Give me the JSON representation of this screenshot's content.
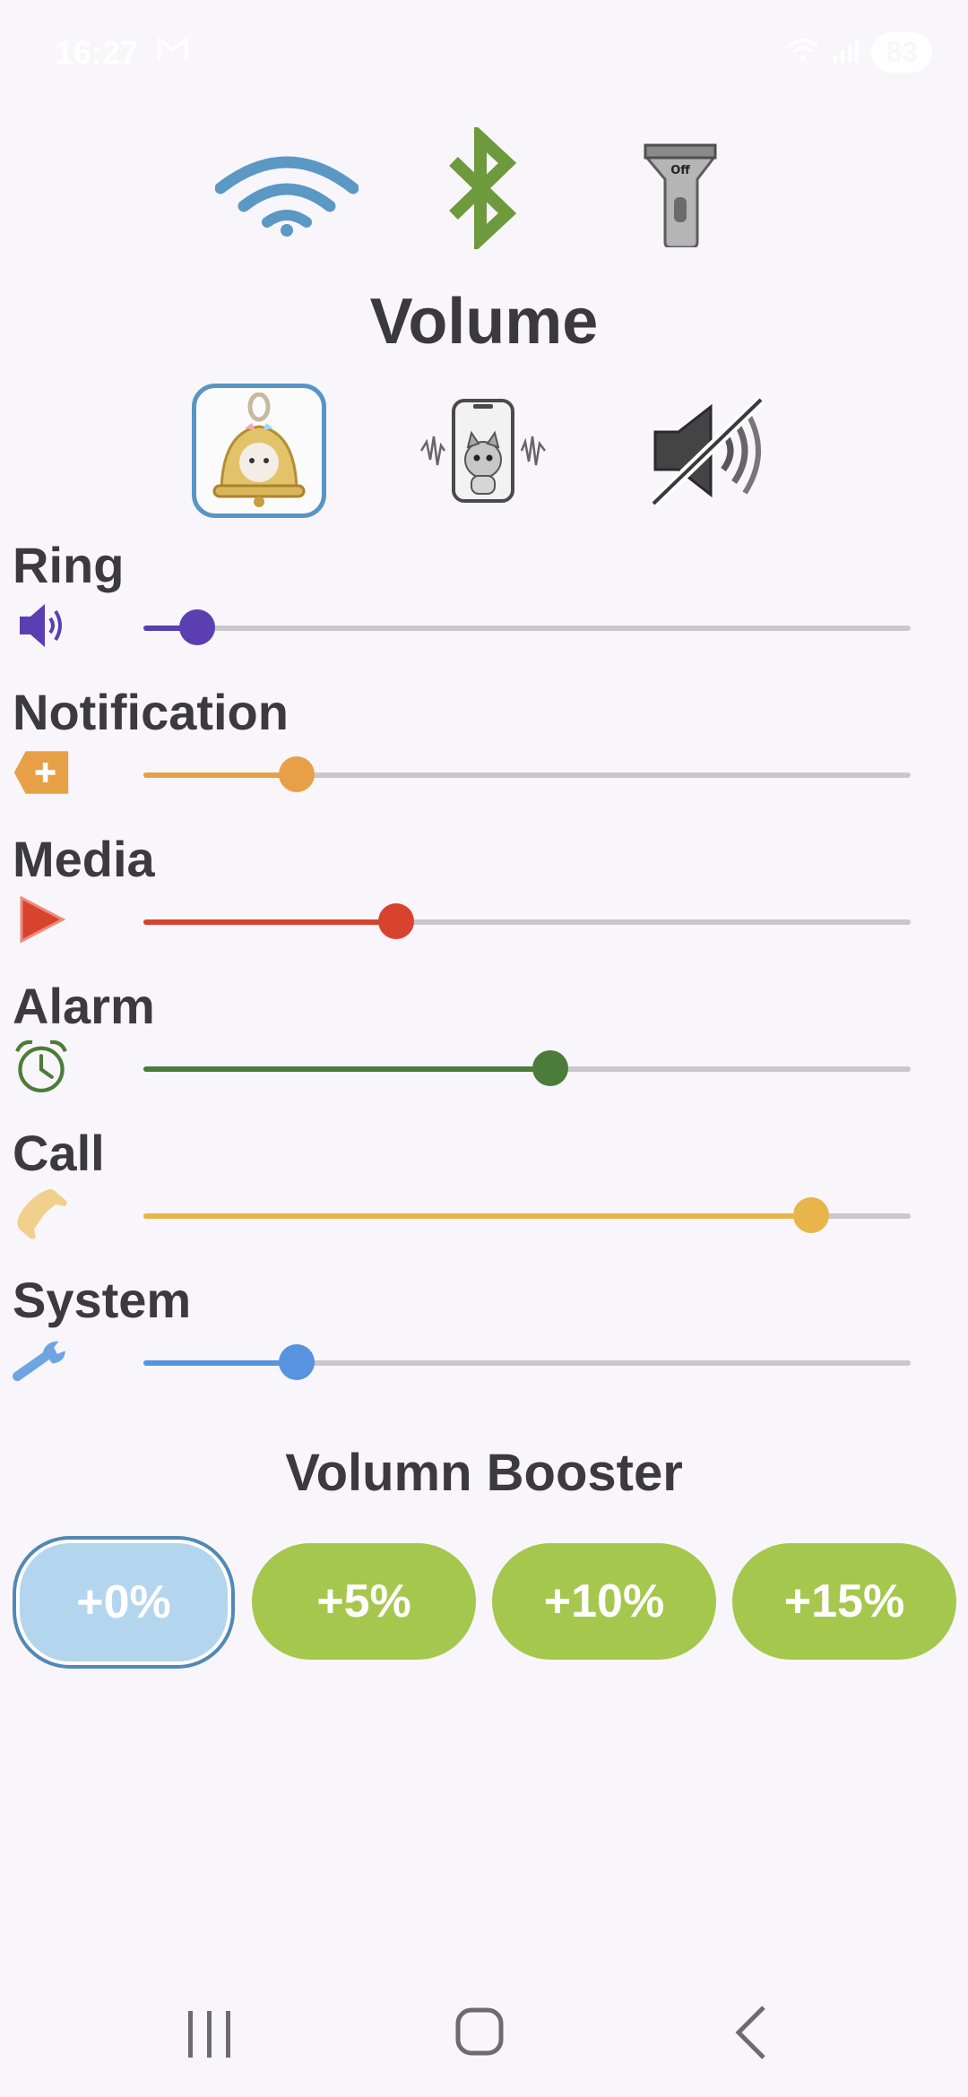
{
  "status_bar": {
    "time": "16:27",
    "battery": "83",
    "icons": [
      "mail-icon",
      "wifi-icon",
      "signal-icon"
    ]
  },
  "quick_toggles": {
    "wifi": {
      "icon": "wifi-icon",
      "color": "#5b98c4"
    },
    "bluetooth": {
      "icon": "bluetooth-icon",
      "color": "#6d9a3c"
    },
    "flashlight": {
      "icon": "flashlight-icon",
      "label": "Off"
    }
  },
  "title": "Volume",
  "modes": [
    {
      "name": "ring",
      "icon": "bell-icon",
      "selected": true
    },
    {
      "name": "vibrate",
      "icon": "vibrate-phone-icon",
      "selected": false
    },
    {
      "name": "silent",
      "icon": "mute-icon",
      "selected": false
    }
  ],
  "volumes": [
    {
      "label": "Ring",
      "icon": "speaker-icon",
      "color": "#5b3fb0",
      "level": 0.07
    },
    {
      "label": "Notification",
      "icon": "notification-plus-icon",
      "color": "#e8a046",
      "level": 0.2
    },
    {
      "label": "Media",
      "icon": "play-icon",
      "color": "#d8432f",
      "level": 0.33
    },
    {
      "label": "Alarm",
      "icon": "alarm-clock-icon",
      "color": "#4c7c3a",
      "level": 0.53
    },
    {
      "label": "Call",
      "icon": "phone-icon",
      "color": "#e8b54a",
      "level": 0.87
    },
    {
      "label": "System",
      "icon": "wrench-icon",
      "color": "#5793de",
      "level": 0.2
    }
  ],
  "booster": {
    "title": "Volumn Booster",
    "options": [
      {
        "label": "+0%",
        "selected": true
      },
      {
        "label": "+5%",
        "selected": false
      },
      {
        "label": "+10%",
        "selected": false
      },
      {
        "label": "+15%",
        "selected": false
      }
    ]
  },
  "nav": {
    "recents": "recents-icon",
    "home": "home-icon",
    "back": "back-icon"
  }
}
